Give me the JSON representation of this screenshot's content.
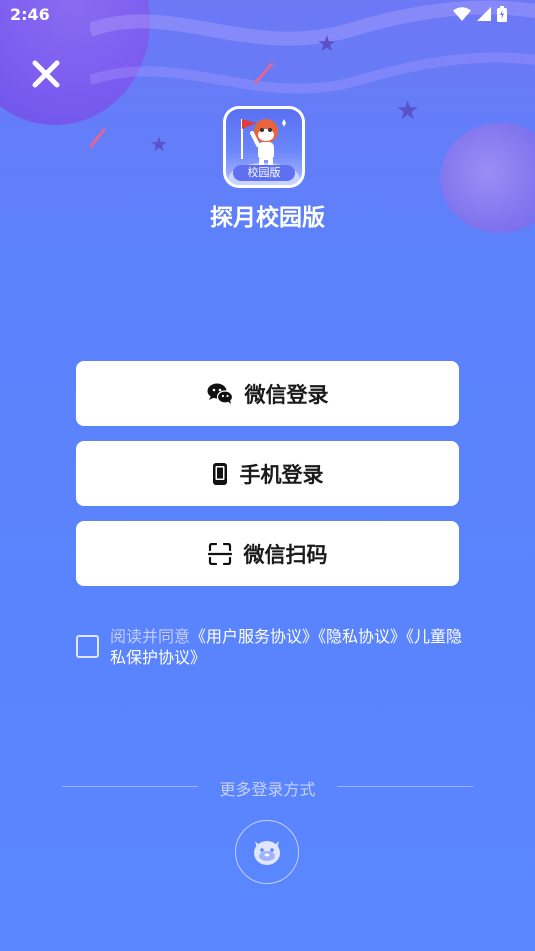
{
  "status_bar": {
    "time": "2:46",
    "icons": [
      "wifi-icon",
      "signal-icon",
      "battery-icon"
    ]
  },
  "app": {
    "badge": "校园版",
    "name": "探月校园版"
  },
  "login_buttons": [
    {
      "label": "微信登录",
      "icon": "wechat-icon"
    },
    {
      "label": "手机登录",
      "icon": "phone-icon"
    },
    {
      "label": "微信扫码",
      "icon": "scan-icon"
    }
  ],
  "agreement": {
    "checked": false,
    "prefix": "阅读并同意",
    "link_1": "《用户服务协议》",
    "link_2": "《隐私协议》",
    "link_3": "《儿童隐私保护协议》"
  },
  "more_login": {
    "label": "更多登录方式",
    "icon": "guest-mascot-icon"
  },
  "colors": {
    "background": "#5a86ff",
    "button_bg": "#ffffff",
    "text_dark": "#1a1a1a"
  }
}
